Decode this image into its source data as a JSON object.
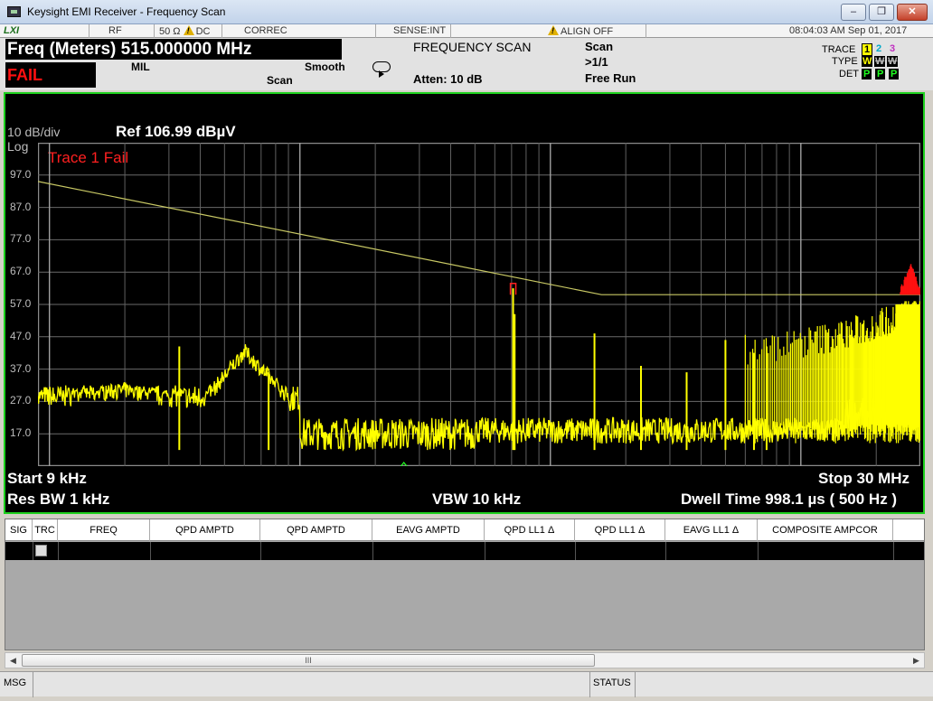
{
  "window": {
    "title": "Keysight EMI Receiver  - Frequency Scan",
    "min": "–",
    "max": "❐",
    "close": "✕"
  },
  "status_strip": {
    "lxi": "LXI",
    "rf": "RF",
    "impedance": "50 Ω",
    "coupling": "DC",
    "correc": "CORREC",
    "sense": "SENSE:INT",
    "align": "ALIGN OFF",
    "timestamp": "08:04:03 AM Sep 01, 2017"
  },
  "meas_bar": {
    "freq_meters": "Freq (Meters) 515.000000 MHz",
    "fail": "FAIL",
    "mil": "MIL",
    "smooth": "Smooth",
    "scan_left": "Scan",
    "mode_title": "FREQUENCY SCAN",
    "atten": "Atten: 10 dB",
    "scan": "Scan",
    "scan_count": ">1/1",
    "free_run": "Free Run",
    "trace_label": "TRACE",
    "type_label": "TYPE",
    "det_label": "DET",
    "trace_nums": [
      "1",
      "2",
      "3"
    ],
    "type_values": [
      "W",
      "W",
      "W"
    ],
    "det_values": [
      "P",
      "P",
      "P"
    ],
    "colors": {
      "trace1": "#ffff00",
      "trace2": "#00e0ff",
      "trace3": "#e040e0",
      "det": "#20ff20"
    }
  },
  "display": {
    "scale": "10 dB/div",
    "scale_type": "Log",
    "ref": "Ref 106.99 dBµV",
    "trace_fail": "Trace 1 Fail",
    "start": "Start 9 kHz",
    "stop": "Stop 30 MHz",
    "res_bw": "Res BW 1 kHz",
    "vbw": "VBW 10 kHz",
    "dwell": "Dwell Time 998.1 µs ( 500 Hz )",
    "y_ticks": [
      "97.0",
      "87.0",
      "77.0",
      "67.0",
      "57.0",
      "47.0",
      "37.0",
      "27.0",
      "17.0"
    ]
  },
  "chart_data": {
    "type": "line",
    "x_scale": "log",
    "x_range_hz": [
      9000,
      30000000
    ],
    "y_range_dbuv": [
      6.99,
      106.99
    ],
    "grid": true,
    "series": [
      {
        "color": "#ffff00",
        "x_mhz": [
          0.009,
          0.02,
          0.04,
          0.06,
          0.1,
          0.15,
          0.2,
          0.3,
          0.5,
          0.7,
          1.0,
          1.5,
          2.0,
          3.0,
          5.0,
          7.0,
          10.0,
          15.0,
          20.0,
          25.0,
          30.0
        ],
        "y": [
          28,
          32,
          27,
          44,
          26,
          24,
          20,
          15,
          17,
          62,
          20,
          21,
          48,
          36,
          40,
          42,
          44,
          43,
          52,
          58,
          56
        ]
      },
      {
        "color": "#c8c864",
        "x_mhz": [
          0.009,
          1.6,
          30.0
        ],
        "y": [
          95,
          60,
          60
        ]
      }
    ]
  },
  "table": {
    "headers": [
      "SIG",
      "TRC",
      "FREQ",
      "QPD AMPTD",
      "QPD AMPTD",
      "EAVG AMPTD",
      "QPD LL1 Δ",
      "QPD LL1 Δ",
      "EAVG LL1 Δ",
      "COMPOSITE AMPCOR"
    ]
  },
  "scrollbar": {
    "left": "◀",
    "right": "▶",
    "thumb": "III"
  },
  "bottom": {
    "msg": "MSG",
    "status": "STATUS"
  }
}
